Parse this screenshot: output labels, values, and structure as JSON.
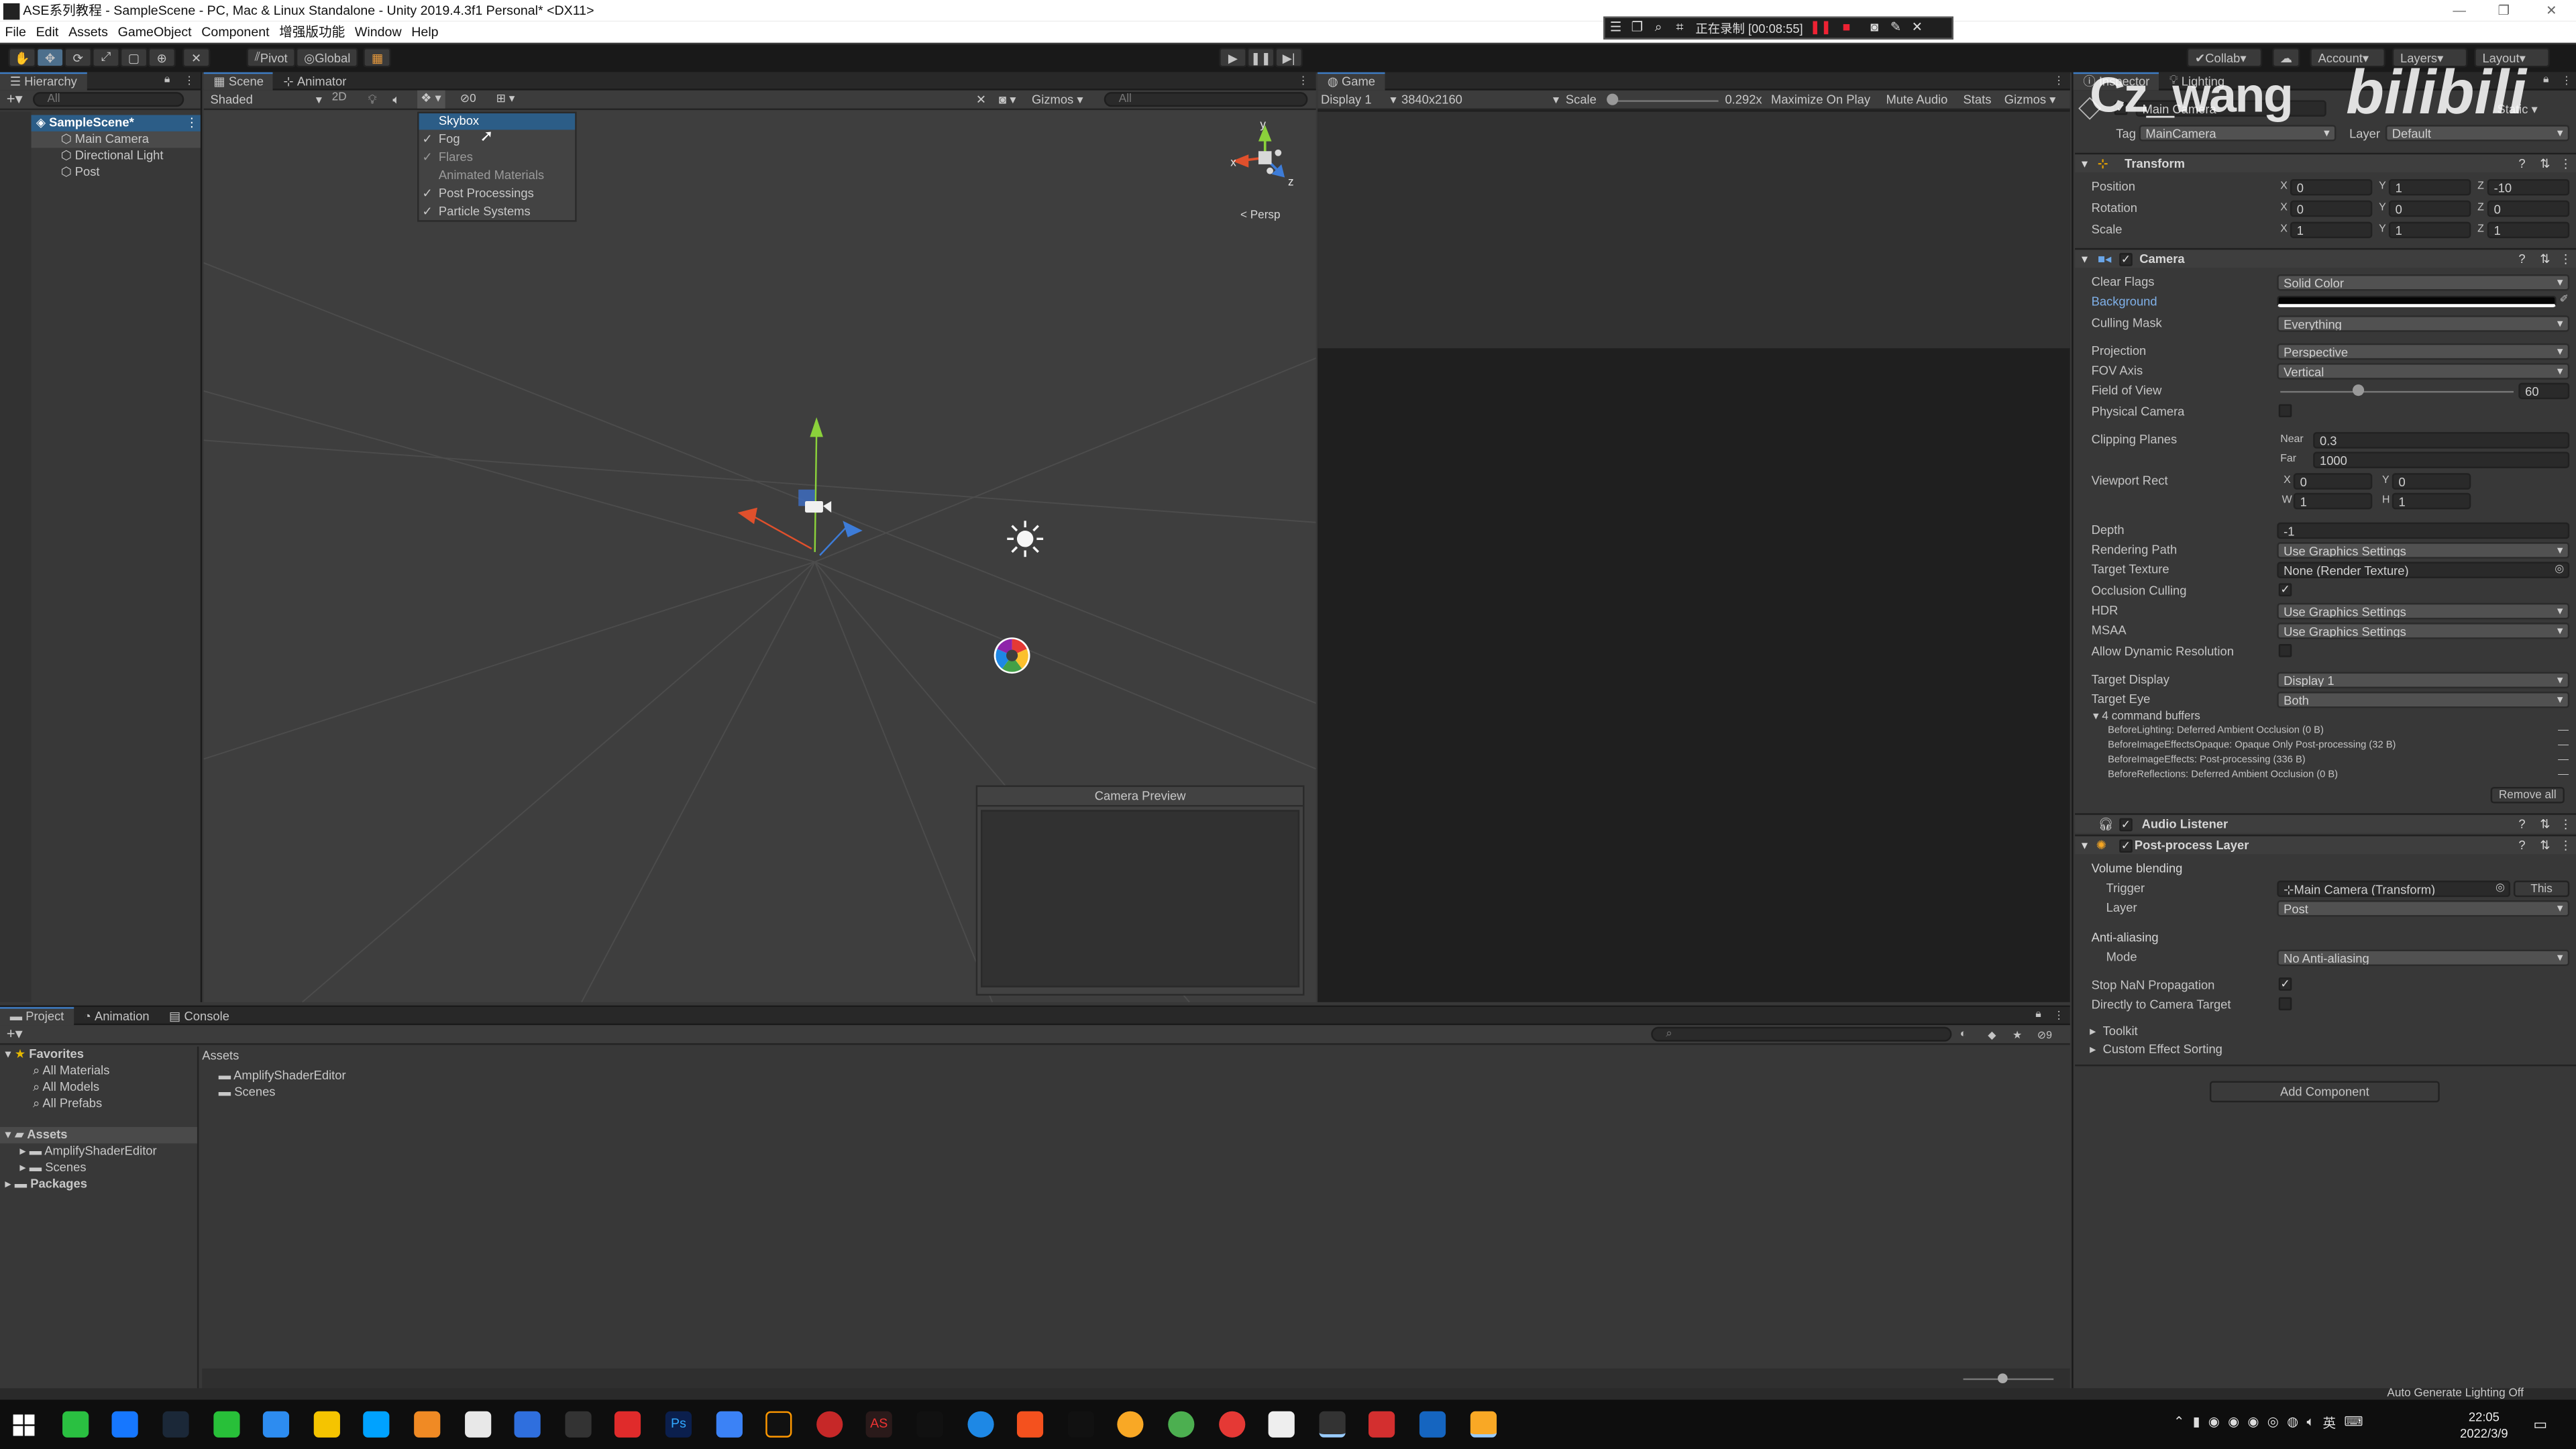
{
  "window": {
    "title": "ASE系列教程 - SampleScene - PC, Mac & Linux Standalone - Unity 2019.4.3f1 Personal* <DX11>"
  },
  "menu": [
    "File",
    "Edit",
    "Assets",
    "GameObject",
    "Component",
    "增强版功能",
    "Window",
    "Help"
  ],
  "recorder": {
    "status": "正在录制 [00:08:55]"
  },
  "toolbar": {
    "pivot": "Pivot",
    "global": "Global",
    "collab": "Collab",
    "account": "Account",
    "layers": "Layers",
    "layout": "Layout"
  },
  "watermark": {
    "author": "Cz_wang",
    "site": "bilibili"
  },
  "hierarchy": {
    "tab": "Hierarchy",
    "search_placeholder": "All",
    "scene": "SampleScene*",
    "items": [
      "Main Camera",
      "Directional Light",
      "Post"
    ]
  },
  "scene": {
    "tabs": [
      "Scene",
      "Animator"
    ],
    "shading": "Shaded",
    "mode2d": "2D",
    "gizmos": "Gizmos",
    "search_placeholder": "All",
    "persp": "< Persp",
    "fx_count": "0",
    "axis_x": "x",
    "axis_y": "y",
    "axis_z": "z"
  },
  "fx_menu": {
    "items": [
      {
        "label": "Skybox",
        "checked": false,
        "selected": true
      },
      {
        "label": "Fog",
        "checked": true
      },
      {
        "label": "Flares",
        "checked": true
      },
      {
        "label": "Animated Materials",
        "checked": false
      },
      {
        "label": "Post Processings",
        "checked": true
      },
      {
        "label": "Particle Systems",
        "checked": true
      }
    ]
  },
  "camera_preview": {
    "title": "Camera Preview"
  },
  "game": {
    "tab": "Game",
    "display": "Display 1",
    "resolution": "3840x2160",
    "scale_label": "Scale",
    "scale_value": "0.292x",
    "maximize": "Maximize On Play",
    "mute": "Mute Audio",
    "stats": "Stats",
    "gizmos": "Gizmos"
  },
  "inspector": {
    "tabs": [
      "Inspector",
      "Lighting"
    ],
    "object": {
      "name": "Main Camera",
      "static": "Static",
      "tag_label": "Tag",
      "tag": "MainCamera",
      "layer_label": "Layer",
      "layer": "Default"
    },
    "transform": {
      "title": "Transform",
      "rows": [
        {
          "label": "Position",
          "x": "0",
          "y": "1",
          "z": "-10"
        },
        {
          "label": "Rotation",
          "x": "0",
          "y": "0",
          "z": "0"
        },
        {
          "label": "Scale",
          "x": "1",
          "y": "1",
          "z": "1"
        }
      ]
    },
    "camera": {
      "title": "Camera",
      "clear_flags_label": "Clear Flags",
      "clear_flags": "Solid Color",
      "background_label": "Background",
      "culling_mask_label": "Culling Mask",
      "culling_mask": "Everything",
      "projection_label": "Projection",
      "projection": "Perspective",
      "fov_axis_label": "FOV Axis",
      "fov_axis": "Vertical",
      "fov_label": "Field of View",
      "fov": "60",
      "fov_fraction": 0.33,
      "physical_label": "Physical Camera",
      "clipping_label": "Clipping Planes",
      "near_label": "Near",
      "near": "0.3",
      "far_label": "Far",
      "far": "1000",
      "viewport_label": "Viewport Rect",
      "vx": "0",
      "vy": "0",
      "vw": "1",
      "vh": "1",
      "depth_label": "Depth",
      "depth": "-1",
      "rendering_path_label": "Rendering Path",
      "rendering_path": "Use Graphics Settings",
      "target_texture_label": "Target Texture",
      "target_texture": "None (Render Texture)",
      "occlusion_label": "Occlusion Culling",
      "hdr_label": "HDR",
      "hdr": "Use Graphics Settings",
      "msaa_label": "MSAA",
      "msaa": "Use Graphics Settings",
      "dynres_label": "Allow Dynamic Resolution",
      "target_display_label": "Target Display",
      "target_display": "Display 1",
      "target_eye_label": "Target Eye",
      "target_eye": "Both",
      "cmd_buffers_title": "4 command buffers",
      "cmd_buffers": [
        "BeforeLighting: Deferred Ambient Occlusion (0 B)",
        "BeforeImageEffectsOpaque: Opaque Only Post-processing (32 B)",
        "BeforeImageEffects: Post-processing (336 B)",
        "BeforeReflections: Deferred Ambient Occlusion (0 B)"
      ],
      "remove_all": "Remove all"
    },
    "audio_listener": {
      "title": "Audio Listener"
    },
    "post_layer": {
      "title": "Post-process Layer",
      "volume_blending": "Volume blending",
      "trigger_label": "Trigger",
      "trigger": "Main Camera (Transform)",
      "this": "This",
      "layer_label": "Layer",
      "layer": "Post",
      "aa_title": "Anti-aliasing",
      "mode_label": "Mode",
      "mode": "No Anti-aliasing",
      "stop_nan": "Stop NaN Propagation",
      "direct": "Directly to Camera Target",
      "toolkit": "Toolkit",
      "custom_sorting": "Custom Effect Sorting"
    },
    "add_component": "Add Component"
  },
  "project": {
    "tabs": [
      "Project",
      "Animation",
      "Console"
    ],
    "favorites": "Favorites",
    "fav_items": [
      "All Materials",
      "All Models",
      "All Prefabs"
    ],
    "assets": "Assets",
    "asset_folders": [
      "AmplifyShaderEditor",
      "Scenes"
    ],
    "packages": "Packages",
    "breadcrumb": "Assets",
    "files": [
      "AmplifyShaderEditor",
      "Scenes"
    ],
    "hidden_count": "9"
  },
  "status": {
    "text": "Auto Generate Lighting Off"
  },
  "taskbar": {
    "time": "22:05",
    "date": "2022/3/9",
    "ime": "英"
  },
  "colors": {
    "accent": "#3d7cc4",
    "selection": "#2c5d87"
  }
}
